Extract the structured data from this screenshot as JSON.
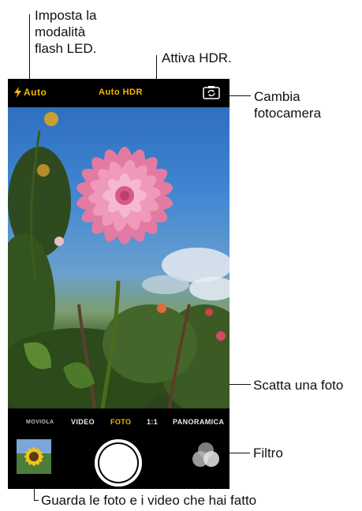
{
  "callouts": {
    "flash": "Imposta la\nmodalità\nflash LED.",
    "hdr": "Attiva HDR.",
    "camera_switch": "Cambia\nfotocamera",
    "shutter": "Scatta una foto",
    "filter": "Filtro",
    "thumbnail": "Guarda le foto e i video che hai fatto"
  },
  "camera": {
    "flash_label": "Auto",
    "hdr_label": "Auto HDR",
    "modes": [
      "MOVIOLA",
      "VIDEO",
      "FOTO",
      "1:1",
      "PANORAMICA"
    ],
    "active_mode": "FOTO"
  },
  "colors": {
    "accent": "#f5b800",
    "bar": "#000000"
  },
  "icons": {
    "flash": "lightning-icon",
    "switch": "camera-switch-icon",
    "filter": "filter-circles-icon"
  }
}
